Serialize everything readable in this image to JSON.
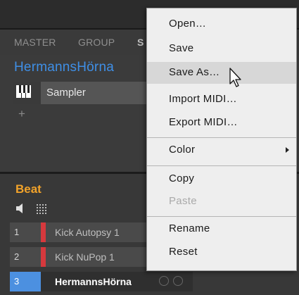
{
  "mixer_tabs": {
    "master": "MASTER",
    "group": "GROUP",
    "sounds": "S"
  },
  "group_name": "HermannsHörna",
  "plugin": {
    "name": "Sampler",
    "add": "+"
  },
  "beat": {
    "title": "Beat",
    "rows": [
      {
        "number": "1",
        "name": "Kick Autopsy 1"
      },
      {
        "number": "2",
        "name": "Kick NuPop 1"
      },
      {
        "number": "3",
        "name": "HermannsHörna"
      }
    ]
  },
  "context_menu": {
    "items": [
      {
        "label": "Open…",
        "enabled": true
      },
      {
        "label": "Save",
        "enabled": true
      },
      {
        "label": "Save As…",
        "enabled": true,
        "hover": true
      },
      {
        "label": "Import MIDI…",
        "enabled": true
      },
      {
        "label": "Export MIDI…",
        "enabled": true
      },
      {
        "label": "Color",
        "enabled": true,
        "submenu": true
      },
      {
        "label": "Copy",
        "enabled": true
      },
      {
        "label": "Paste",
        "enabled": false
      },
      {
        "label": "Rename",
        "enabled": true
      },
      {
        "label": "Reset",
        "enabled": true
      }
    ]
  },
  "colors": {
    "group_name": "#3f8fe6",
    "beat_title": "#f2a32a",
    "sound_strip": "#d6393d",
    "selected_row": "#4c90e0",
    "menu_background": "#eeeeee"
  },
  "icons": [
    "piano-keyboard-icon",
    "speaker-icon",
    "grid-icon",
    "submenu-arrow-icon",
    "mouse-pointer-icon"
  ]
}
